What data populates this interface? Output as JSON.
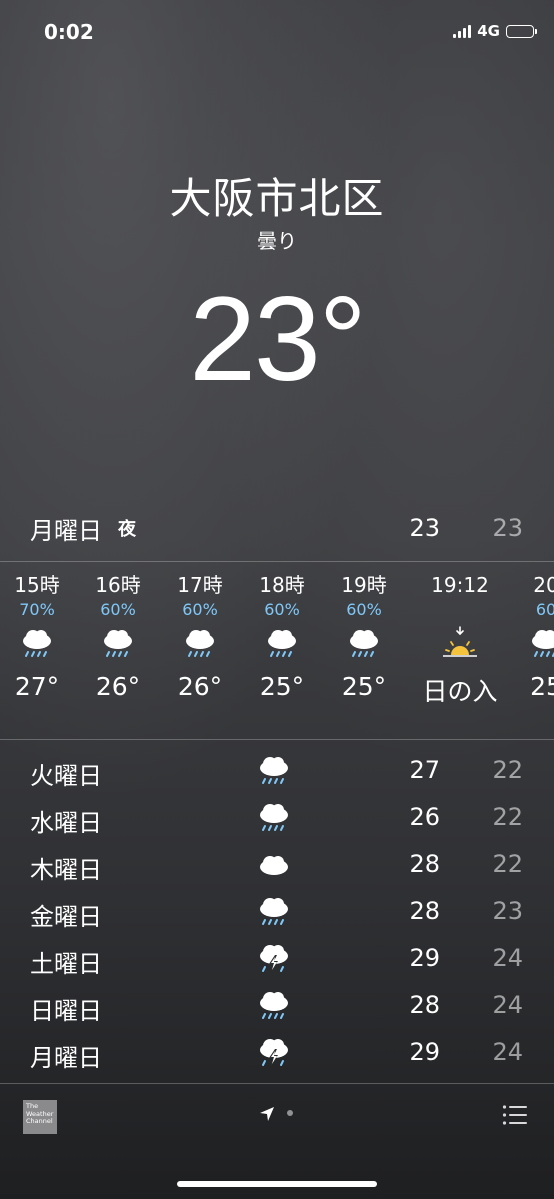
{
  "status": {
    "time": "0:02",
    "network": "4G"
  },
  "location": {
    "city": "大阪市北区",
    "condition": "曇り",
    "temperature": "23°"
  },
  "today": {
    "day": "月曜日",
    "tag": "夜",
    "high": "23",
    "low": "23"
  },
  "hourly": [
    {
      "label": "15時",
      "pop": "70%",
      "icon": "cloud-rain-icon",
      "temp": "27°"
    },
    {
      "label": "16時",
      "pop": "60%",
      "icon": "cloud-rain-icon",
      "temp": "26°"
    },
    {
      "label": "17時",
      "pop": "60%",
      "icon": "cloud-rain-icon",
      "temp": "26°"
    },
    {
      "label": "18時",
      "pop": "60%",
      "icon": "cloud-rain-icon",
      "temp": "25°"
    },
    {
      "label": "19時",
      "pop": "60%",
      "icon": "cloud-rain-icon",
      "temp": "25°"
    },
    {
      "label": "19:12",
      "pop": "",
      "icon": "sunset-icon",
      "temp": "日の入"
    },
    {
      "label": "20",
      "pop": "60",
      "icon": "cloud-rain-icon",
      "temp": "25"
    }
  ],
  "daily": [
    {
      "day": "火曜日",
      "icon": "cloud-rain-icon",
      "high": "27",
      "low": "22"
    },
    {
      "day": "水曜日",
      "icon": "cloud-rain-icon",
      "high": "26",
      "low": "22"
    },
    {
      "day": "木曜日",
      "icon": "cloud-icon",
      "high": "28",
      "low": "22"
    },
    {
      "day": "金曜日",
      "icon": "cloud-rain-icon",
      "high": "28",
      "low": "23"
    },
    {
      "day": "土曜日",
      "icon": "thunderstorm-icon",
      "high": "29",
      "low": "24"
    },
    {
      "day": "日曜日",
      "icon": "cloud-rain-icon",
      "high": "28",
      "low": "24"
    },
    {
      "day": "月曜日",
      "icon": "thunderstorm-icon",
      "high": "29",
      "low": "24"
    }
  ],
  "footer": {
    "provider": "The Weather Channel"
  },
  "colors": {
    "precip": "#7fc8f8",
    "sun": "#f5c33b"
  }
}
